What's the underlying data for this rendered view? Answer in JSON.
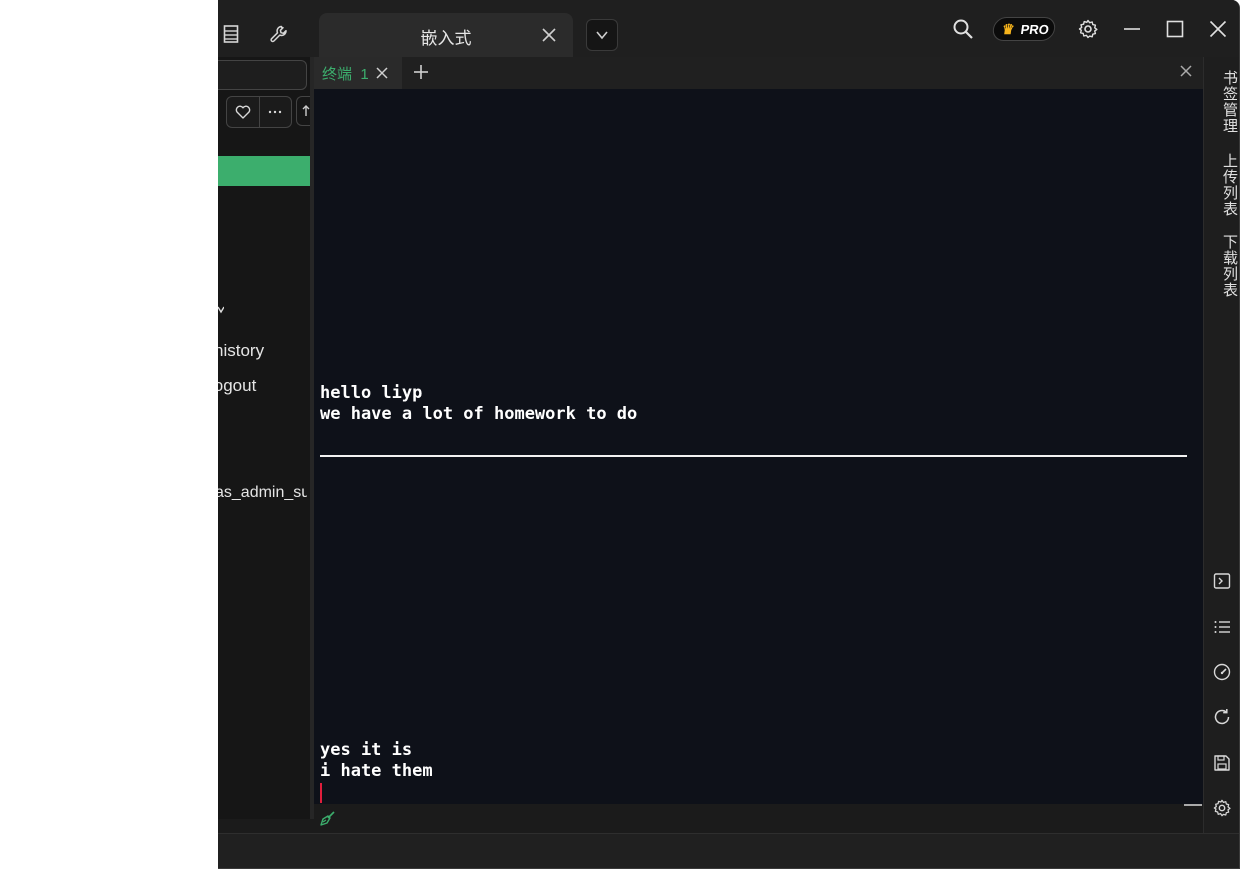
{
  "titlebar": {
    "doc_tab_label": "嵌入式",
    "pro_label": "PRO",
    "icons": [
      "list-icon",
      "wrench-icon",
      "search-icon",
      "gear-icon",
      "minimize-icon",
      "maximize-icon",
      "close-icon"
    ]
  },
  "sidebar": {
    "items": [
      "history",
      "logout",
      "as_admin_suc"
    ]
  },
  "terminal_tabs": [
    {
      "label": "终端",
      "index": "1"
    }
  ],
  "terminal": {
    "lines_top": [
      "hello liyp",
      "we have a lot of homework to do"
    ],
    "lines_bottom": [
      "yes it is",
      "i hate them"
    ]
  },
  "right_panel": {
    "tabs": [
      "书签管理",
      "上传列表",
      "下载列表"
    ],
    "icons": [
      "terminal-icon",
      "list-icon",
      "gauge-icon",
      "refresh-icon",
      "save-icon",
      "settings-icon"
    ]
  },
  "colors": {
    "accent": "#3cae6d",
    "terminal_bg": "#0e1119",
    "cursor": "#e01e3c"
  }
}
